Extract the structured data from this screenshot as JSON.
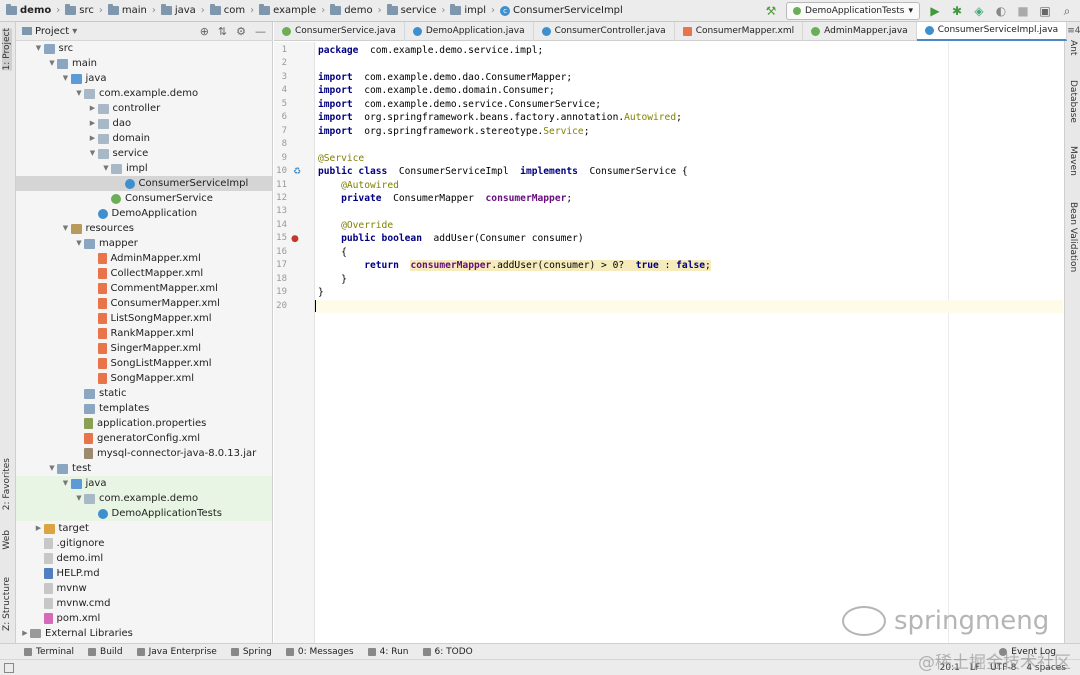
{
  "breadcrumb": [
    "demo",
    "src",
    "main",
    "java",
    "com",
    "example",
    "demo",
    "service",
    "impl",
    "ConsumerServiceImpl"
  ],
  "run_config": "DemoApplicationTests",
  "left_tabs": [
    "1: Project",
    "2: Favorites",
    "Web",
    "Z: Structure"
  ],
  "right_tabs": [
    "Ant",
    "Database",
    "Maven",
    "Bean Validation"
  ],
  "project_panel": {
    "title": "Project"
  },
  "tree": [
    {
      "label": "src",
      "depth": 1,
      "arrow": "down",
      "icon": "folder"
    },
    {
      "label": "main",
      "depth": 2,
      "arrow": "down",
      "icon": "folder"
    },
    {
      "label": "java",
      "depth": 3,
      "arrow": "down",
      "icon": "folder-src"
    },
    {
      "label": "com.example.demo",
      "depth": 4,
      "arrow": "down",
      "icon": "pkg"
    },
    {
      "label": "controller",
      "depth": 5,
      "arrow": "right",
      "icon": "pkg"
    },
    {
      "label": "dao",
      "depth": 5,
      "arrow": "right",
      "icon": "pkg"
    },
    {
      "label": "domain",
      "depth": 5,
      "arrow": "right",
      "icon": "pkg"
    },
    {
      "label": "service",
      "depth": 5,
      "arrow": "down",
      "icon": "pkg"
    },
    {
      "label": "impl",
      "depth": 6,
      "arrow": "down",
      "icon": "pkg"
    },
    {
      "label": "ConsumerServiceImpl",
      "depth": 7,
      "arrow": "",
      "icon": "cls",
      "selected": true
    },
    {
      "label": "ConsumerService",
      "depth": 6,
      "arrow": "",
      "icon": "int"
    },
    {
      "label": "DemoApplication",
      "depth": 5,
      "arrow": "",
      "icon": "cls"
    },
    {
      "label": "resources",
      "depth": 3,
      "arrow": "down",
      "icon": "folder-res"
    },
    {
      "label": "mapper",
      "depth": 4,
      "arrow": "down",
      "icon": "folder"
    },
    {
      "label": "AdminMapper.xml",
      "depth": 5,
      "arrow": "",
      "icon": "xml"
    },
    {
      "label": "CollectMapper.xml",
      "depth": 5,
      "arrow": "",
      "icon": "xml"
    },
    {
      "label": "CommentMapper.xml",
      "depth": 5,
      "arrow": "",
      "icon": "xml"
    },
    {
      "label": "ConsumerMapper.xml",
      "depth": 5,
      "arrow": "",
      "icon": "xml"
    },
    {
      "label": "ListSongMapper.xml",
      "depth": 5,
      "arrow": "",
      "icon": "xml"
    },
    {
      "label": "RankMapper.xml",
      "depth": 5,
      "arrow": "",
      "icon": "xml"
    },
    {
      "label": "SingerMapper.xml",
      "depth": 5,
      "arrow": "",
      "icon": "xml"
    },
    {
      "label": "SongListMapper.xml",
      "depth": 5,
      "arrow": "",
      "icon": "xml"
    },
    {
      "label": "SongMapper.xml",
      "depth": 5,
      "arrow": "",
      "icon": "xml"
    },
    {
      "label": "static",
      "depth": 4,
      "arrow": "",
      "icon": "folder"
    },
    {
      "label": "templates",
      "depth": 4,
      "arrow": "",
      "icon": "folder"
    },
    {
      "label": "application.properties",
      "depth": 4,
      "arrow": "",
      "icon": "prop"
    },
    {
      "label": "generatorConfig.xml",
      "depth": 4,
      "arrow": "",
      "icon": "xml"
    },
    {
      "label": "mysql-connector-java-8.0.13.jar",
      "depth": 4,
      "arrow": "",
      "icon": "jar"
    },
    {
      "label": "test",
      "depth": 2,
      "arrow": "down",
      "icon": "folder"
    },
    {
      "label": "java",
      "depth": 3,
      "arrow": "down",
      "icon": "folder-src",
      "green": true
    },
    {
      "label": "com.example.demo",
      "depth": 4,
      "arrow": "down",
      "icon": "pkg",
      "green": true
    },
    {
      "label": "DemoApplicationTests",
      "depth": 5,
      "arrow": "",
      "icon": "cls",
      "green": true
    },
    {
      "label": "target",
      "depth": 1,
      "arrow": "right",
      "icon": "folder-or"
    },
    {
      "label": ".gitignore",
      "depth": 1,
      "arrow": "",
      "icon": "file"
    },
    {
      "label": "demo.iml",
      "depth": 1,
      "arrow": "",
      "icon": "file"
    },
    {
      "label": "HELP.md",
      "depth": 1,
      "arrow": "",
      "icon": "md"
    },
    {
      "label": "mvnw",
      "depth": 1,
      "arrow": "",
      "icon": "file"
    },
    {
      "label": "mvnw.cmd",
      "depth": 1,
      "arrow": "",
      "icon": "file"
    },
    {
      "label": "pom.xml",
      "depth": 1,
      "arrow": "",
      "icon": "maven"
    },
    {
      "label": "External Libraries",
      "depth": 0,
      "arrow": "right",
      "icon": "lib"
    }
  ],
  "tabs": [
    {
      "label": "ConsumerService.java",
      "icon": "i"
    },
    {
      "label": "DemoApplication.java",
      "icon": "c"
    },
    {
      "label": "ConsumerController.java",
      "icon": "c"
    },
    {
      "label": "ConsumerMapper.xml",
      "icon": "x"
    },
    {
      "label": "AdminMapper.java",
      "icon": "i"
    },
    {
      "label": "ConsumerServiceImpl.java",
      "icon": "c",
      "active": true
    }
  ],
  "tabs_more": "≡4",
  "code_lines": [
    [
      [
        "kw",
        "package"
      ],
      [
        "",
        "  com.example.demo.service.impl;"
      ]
    ],
    [],
    [
      [
        "kw",
        "import"
      ],
      [
        "",
        "  com.example.demo.dao.ConsumerMapper;"
      ]
    ],
    [
      [
        "kw",
        "import"
      ],
      [
        "",
        "  com.example.demo.domain.Consumer;"
      ]
    ],
    [
      [
        "kw",
        "import"
      ],
      [
        "",
        "  com.example.demo.service.ConsumerService;"
      ]
    ],
    [
      [
        "kw",
        "import"
      ],
      [
        "",
        "  org.springframework.beans.factory.annotation."
      ],
      [
        "ann",
        "Autowired"
      ],
      [
        "",
        ";"
      ]
    ],
    [
      [
        "kw",
        "import"
      ],
      [
        "",
        "  org.springframework.stereotype."
      ],
      [
        "ann",
        "Service"
      ],
      [
        "",
        ";"
      ]
    ],
    [],
    [
      [
        "ann",
        "@Service"
      ]
    ],
    [
      [
        "kw",
        "public class"
      ],
      [
        "",
        "  ConsumerServiceImpl  "
      ],
      [
        "kw",
        "implements"
      ],
      [
        "",
        "  ConsumerService {"
      ]
    ],
    [
      [
        "",
        "    "
      ],
      [
        "ann",
        "@Autowired"
      ]
    ],
    [
      [
        "",
        "    "
      ],
      [
        "kw",
        "private"
      ],
      [
        "",
        "  ConsumerMapper  "
      ],
      [
        "fld",
        "consumerMapper"
      ],
      [
        "",
        ";"
      ]
    ],
    [],
    [
      [
        "",
        "    "
      ],
      [
        "ann",
        "@Override"
      ]
    ],
    [
      [
        "",
        "    "
      ],
      [
        "kw",
        "public boolean"
      ],
      [
        "",
        "  addUser(Consumer consumer)"
      ]
    ],
    [
      [
        "",
        "    {"
      ]
    ],
    [
      [
        "",
        "        "
      ],
      [
        "kw",
        "return"
      ],
      [
        "",
        "  "
      ],
      [
        "hlf",
        "consumerMapper"
      ],
      [
        "hl",
        ".addUser(consumer) > 0?  "
      ],
      [
        "hlk",
        "true"
      ],
      [
        "hl",
        " : "
      ],
      [
        "hlk",
        "false"
      ],
      [
        "hl",
        ";"
      ]
    ],
    [
      [
        "",
        "    }"
      ]
    ],
    [
      [
        "",
        "}"
      ]
    ],
    []
  ],
  "bottom_tools": [
    {
      "label": "Terminal"
    },
    {
      "label": "Build"
    },
    {
      "label": "Java Enterprise"
    },
    {
      "label": "Spring"
    },
    {
      "label": "0: Messages"
    },
    {
      "label": "4: Run"
    },
    {
      "label": "6: TODO"
    }
  ],
  "event_log": "Event Log",
  "status": {
    "position": "20:1",
    "line_sep": "LF",
    "encoding": "UTF-8",
    "indent": "4 spaces"
  },
  "watermark": "springmeng",
  "watermark2": "@稀土掘金技术社区"
}
